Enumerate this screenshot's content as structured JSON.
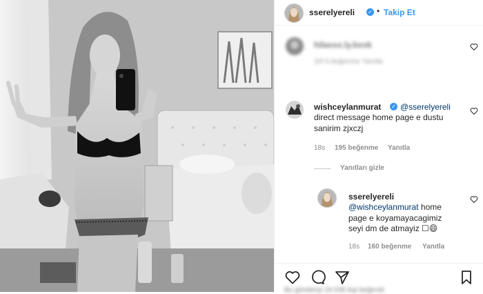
{
  "header": {
    "username": "sserelyereli",
    "follow_label": "Takip Et",
    "separator": "•"
  },
  "blurred_comment": {
    "username": "hilaxxx.ly.bxxk",
    "meta": "1hf  6 beğenme   Yanıtla"
  },
  "comment": {
    "username": "wishceylanmurat",
    "mention": "@sserelyereli",
    "text_line1": "direct message home page e dustu",
    "text_line2": "sanirim zjxczj",
    "time": "18s",
    "likes": "195 beğenme",
    "reply": "Yanıtla",
    "hide_replies": "Yanıtları gizle"
  },
  "reply": {
    "username": "sserelyereli",
    "mention": "@wishceylanmurat",
    "text_after_mention": " home",
    "text_line2": "page e koyamayacagimiz",
    "text_line3": "seyi dm de atmayiz ☐😄",
    "time": "18s",
    "likes": "160 beğenme",
    "reply": "Yanıtla"
  },
  "footer_blurred": "Bu gönderiyi 24.536 kişi beğendi",
  "icons": [
    "heart-icon",
    "comment-icon",
    "share-icon",
    "bookmark-icon",
    "verified-badge-icon"
  ],
  "colors": {
    "link_blue": "#3897f0",
    "mention_blue": "#00376b",
    "meta_grey": "#8e8e8e"
  }
}
